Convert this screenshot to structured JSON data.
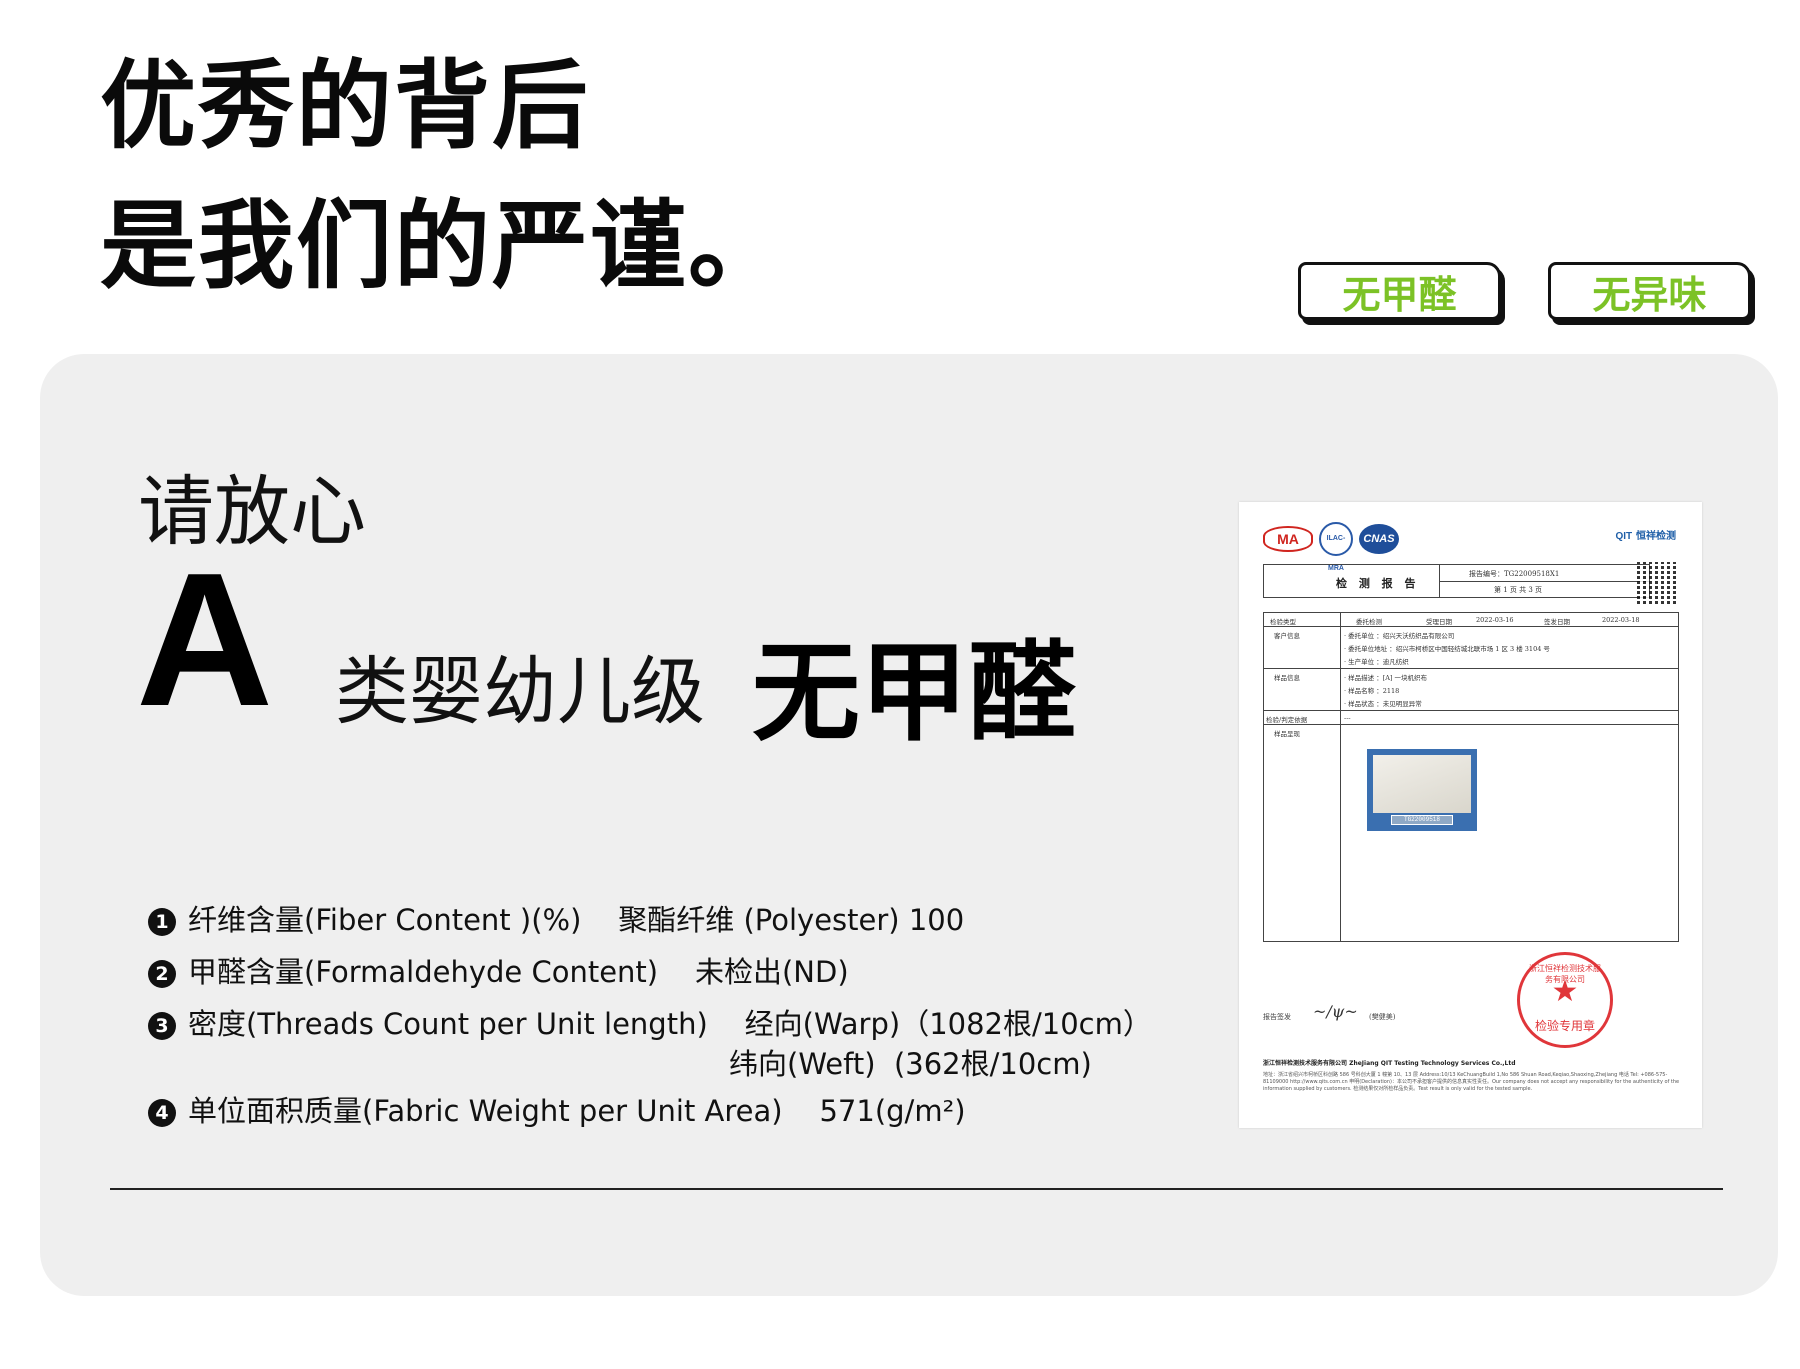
{
  "header": {
    "line1": "优秀的背后",
    "line2": "是我们的严谨。"
  },
  "badges": [
    "无甲醛",
    "无异味"
  ],
  "panel": {
    "assurance": "请放心",
    "grade_letter": "A",
    "grade_desc": "类婴幼儿级",
    "grade_strong": "无甲醛",
    "specs": [
      {
        "num": "1",
        "text": "纤维含量(Fiber Content )(%)    聚酯纤维 (Polyester) 100"
      },
      {
        "num": "2",
        "text": "甲醛含量(Formaldehyde Content)    未检出(ND)"
      },
      {
        "num": "3",
        "text": "密度(Threads Count per Unit length)    经向(Warp)（1082根/10cm）"
      },
      {
        "num": "",
        "text": "纬向(Weft)  (362根/10cm)"
      },
      {
        "num": "4",
        "text": "单位面积质量(Fabric Weight per Unit Area)    571(g/m²)"
      }
    ]
  },
  "report": {
    "logo_ma": "MA",
    "logo_ilac": "ILAC-MRA",
    "logo_cnas": "CNAS",
    "logo_qit": "QIT",
    "logo_qit_cn": "恒祥检测",
    "title": "检 测 报 告",
    "report_no": "报告编号：TG22009518X1",
    "page": "第 1 页  共 3 页",
    "rows": [
      {
        "label": "检验类型",
        "v1": "委托检测",
        "v2": "受理日期",
        "v3": "2022-03-16",
        "v4": "签发日期",
        "v5": "2022-03-18"
      },
      {
        "label": "客户信息",
        "lines": [
          "· 委托单位    ：绍兴天沃纺织品有限公司",
          "· 委托单位地址  ：绍兴市柯桥区中国轻纺城北联市场 1 区 3 楼 3104 号",
          "· 生产单位    ：迪凡纺织"
        ]
      },
      {
        "label": "样品信息",
        "lines": [
          "· 样品描述    ：[A] 一块机织布",
          "· 样品名称    ：2118",
          "· 样品状态    ：未见明显异常"
        ]
      },
      {
        "label": "检验/判定依据",
        "lines": [
          "---"
        ]
      },
      {
        "label": "样品呈现",
        "lines": []
      }
    ],
    "sample_tag": "TG22009518",
    "sign_label": "报告签发",
    "sign_name": "(樊健美)",
    "stamp_arc": "浙江恒祥检测技术服务有限公司",
    "stamp_text": "检验专用章",
    "footer_company": "浙江恒祥检测技术服务有限公司  ZheJiang QIT Testing Technology Services Co.,Ltd",
    "footer_note": "地址：浙江省绍兴市柯桥区科创路 586 号科创大厦 1 幢第 10、13 层  Address:10/13 KeChuangBuild 1,No 586 Shuan Road,Keqiao,Shaoxing,Zhejiang  电话 Tel: +086-575-81109000  http://www.qits.com.cn  申明(Declaration)：本公司不承担客户提供的信息真实性责任。Our company does not accept any responsibility for the authenticity of the information supplied by customers.  检测结果仅对所检样品负责。Test result is only valid for the tested sample."
  },
  "colors": {
    "accent_green": "#7cc226",
    "panel_bg": "#efefef",
    "stamp_red": "#e0363a"
  }
}
